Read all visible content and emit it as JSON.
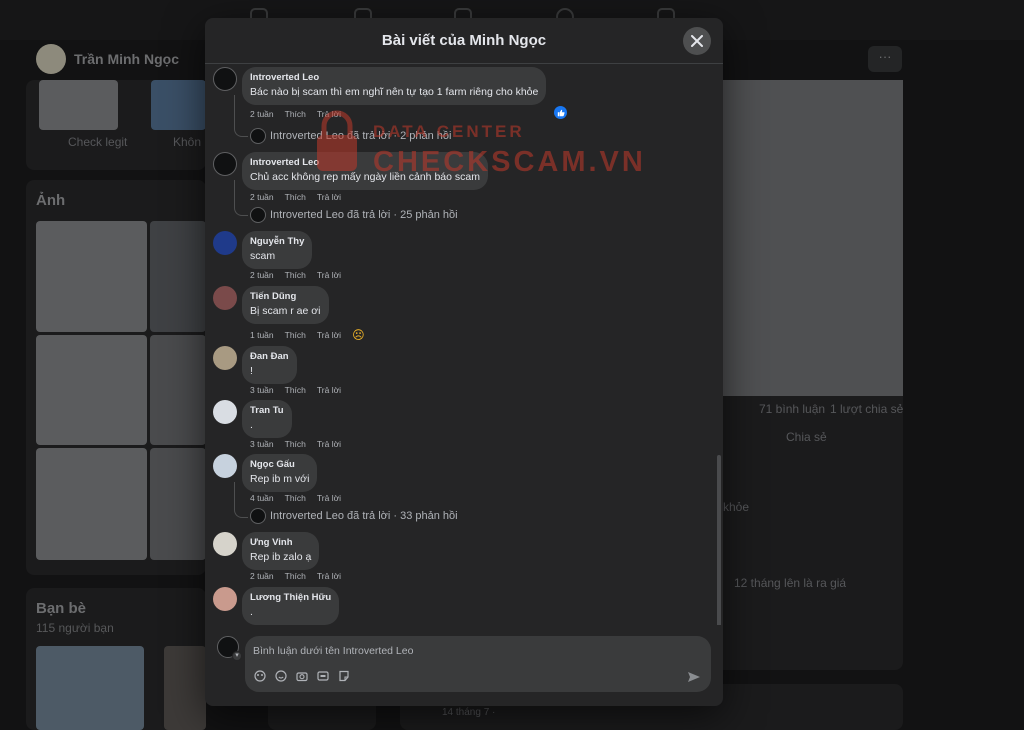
{
  "background": {
    "profile_name": "Trần Minh Ngọc",
    "check_legit": "Check legit",
    "khong": "Khôn",
    "photos_title": "Ảnh",
    "friends_title": "Bạn bè",
    "friends_count": "115 người bạn",
    "comments_count": "71 bình luận",
    "shares_count": "1 lượt chia sẻ",
    "share_button": "Chia sẻ",
    "behind_text": "khỏe",
    "behind_text2": "12 tháng lên là ra giá",
    "post_time": "14 tháng 7 · "
  },
  "modal": {
    "title": "Bài viết của Minh Ngọc",
    "close_icon": "close-icon"
  },
  "actions": {
    "like": "Thích",
    "reply": "Trả lời"
  },
  "comments": [
    {
      "author": "Introverted Leo",
      "text": "Bác nào bị scam thì em nghĩ nên tự tạo 1 farm riêng cho khỏe",
      "time": "2 tuần",
      "reaction": "like",
      "replies": "Introverted Leo đã trả lời · 2 phản hồi"
    },
    {
      "author": "Introverted Leo",
      "text": "Chủ acc không rep mấy ngày liền cảnh báo scam",
      "time": "2 tuần",
      "replies": "Introverted Leo đã trả lời · 25 phản hồi"
    },
    {
      "author": "Nguyễn Thy",
      "text": "scam",
      "time": "2 tuần"
    },
    {
      "author": "Tiến Dũng",
      "text": "Bị scam r ae ơi",
      "time": "1 tuần",
      "reaction": "sad"
    },
    {
      "author": "Đan Đan",
      "text": "!",
      "time": "3 tuần"
    },
    {
      "author": "Tran Tu",
      "text": ".",
      "time": "3 tuần"
    },
    {
      "author": "Ngọc Gấu",
      "text": "Rep ib m với",
      "time": "4 tuần",
      "replies": "Introverted Leo đã trả lời · 33 phản hồi"
    },
    {
      "author": "Ưng Vinh",
      "text": "Rep ib zalo ạ",
      "time": "2 tuần"
    },
    {
      "author": "Lương Thiện Hữu",
      "text": "."
    }
  ],
  "composer": {
    "placeholder": "Bình luận dưới tên Introverted Leo"
  },
  "watermark": {
    "line1": "DATA CENTER",
    "line2": "CHECKSCAM.VN"
  },
  "colors": {
    "accent": "#1877f2",
    "watermark": "#c0392b",
    "bubble": "#3a3b3c",
    "modal_bg": "#252526"
  }
}
